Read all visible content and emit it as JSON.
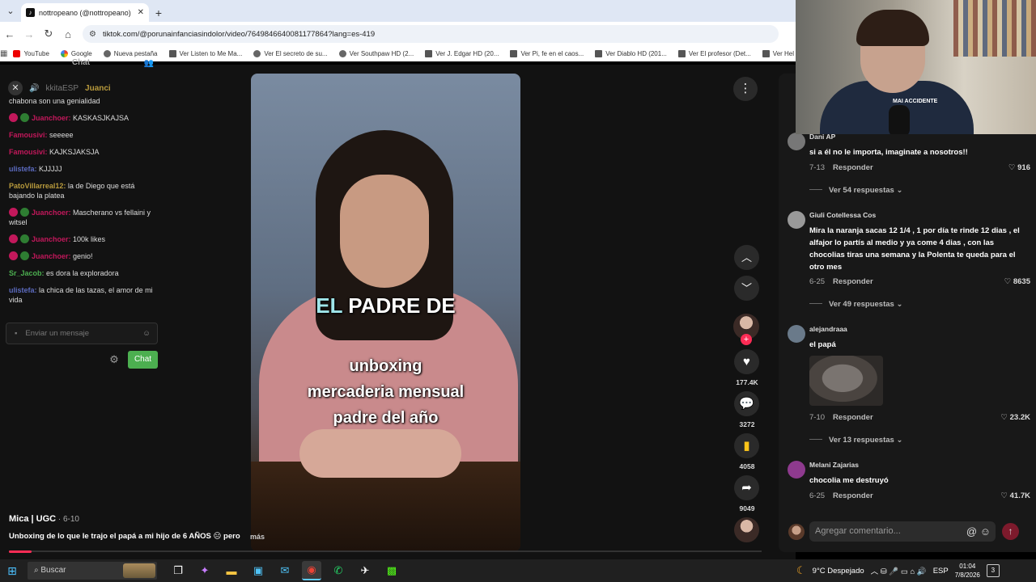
{
  "browser": {
    "tab_title": "nottropeano (@nottropeano) |",
    "url": "tiktok.com/@porunainfanciasindolor/video/7649846640081177864?lang=es-419",
    "bookmarks": [
      {
        "label": "YouTube",
        "icon": "youtube-icon"
      },
      {
        "label": "Google",
        "icon": "google-icon"
      },
      {
        "label": "Nueva pestaña",
        "icon": "globe-icon"
      },
      {
        "label": "Ver Listen to Me Ma...",
        "icon": "page-icon"
      },
      {
        "label": "Ver El secreto de su...",
        "icon": "globe-icon"
      },
      {
        "label": "Ver Southpaw HD (2...",
        "icon": "globe-icon"
      },
      {
        "label": "Ver J. Edgar HD (20...",
        "icon": "page-icon"
      },
      {
        "label": "Ver Pi, fe en el caos...",
        "icon": "page-icon"
      },
      {
        "label": "Ver Diablo HD (201...",
        "icon": "page-icon"
      },
      {
        "label": "Ver El profesor (Det...",
        "icon": "page-icon"
      },
      {
        "label": "Ver Hel",
        "icon": "page-icon"
      }
    ]
  },
  "chat": {
    "header": "Chat",
    "tabs": [
      "kkitaESP",
      "Juanci"
    ],
    "messages": [
      {
        "user": "",
        "text": "chabona son una genialidad",
        "color": "#dddddd",
        "badges": false
      },
      {
        "user": "Juanchoer:",
        "text": " KASKASJKAJSA",
        "color": "#c2185b",
        "badges": true
      },
      {
        "user": "Famousivi:",
        "text": " seeeee",
        "color": "#c2185b",
        "badges": false
      },
      {
        "user": "Famousivi:",
        "text": " KAJKSJAKSJA",
        "color": "#c2185b",
        "badges": false
      },
      {
        "user": "ulistefa:",
        "text": " KJJJJJ",
        "color": "#5c6bc0",
        "badges": false
      },
      {
        "user": "PatoVillarreal12:",
        "text": " la de Diego que está bajando la platea",
        "color": "#b89a3c",
        "badges": false
      },
      {
        "user": "Juanchoer:",
        "text": " Mascherano vs fellaini y witsel",
        "color": "#c2185b",
        "badges": true
      },
      {
        "user": "Juanchoer:",
        "text": " 100k likes",
        "color": "#c2185b",
        "badges": true
      },
      {
        "user": "Juanchoer:",
        "text": " genio!",
        "color": "#c2185b",
        "badges": true
      },
      {
        "user": "Sr_Jacob:",
        "text": " es dora la exploradora",
        "color": "#4caf50",
        "badges": false
      },
      {
        "user": "ulistefa:",
        "text": " la chica de las tazas, el amor de mi vida",
        "color": "#5c6bc0",
        "badges": false
      }
    ],
    "input_placeholder": "Enviar un mensaje",
    "send_label": "Chat"
  },
  "video": {
    "caption_hl": "EL",
    "caption_rest": " PADRE DE",
    "caption_lines": [
      "unboxing",
      "mercaderia mensual",
      "padre del año"
    ],
    "author": "Mica | UGC",
    "date": " · 6-10",
    "description": "Unboxing de lo que le trajo el papá a mi hijo de 6 AÑOS 😑 pero",
    "more": "más",
    "likes": "177.4K",
    "comments": "3272",
    "saves": "4058",
    "shares": "9049",
    "progress_pct": 3
  },
  "comments": [
    {
      "name": "Dani AP",
      "text": "si a él no le importa, imaginate a nosotros!!",
      "date": "7-13",
      "reply": "Responder",
      "likes": "916",
      "replies": "Ver 54 respuestas"
    },
    {
      "name": "Giuli Cotellessa Cos",
      "text": "Mira la naranja sacas 12 1/4 , 1 por día te rinde 12 dias , el alfajor lo partís al medio y ya come 4 dias , con las chocolias tiras una semana y la Polenta te queda para el otro mes",
      "date": "6-25",
      "reply": "Responder",
      "likes": "8635",
      "replies": "Ver 49 respuestas"
    },
    {
      "name": "alejandraaa",
      "text": "el papá",
      "date": "7-10",
      "reply": "Responder",
      "likes": "23.2K",
      "replies": "Ver 13 respuestas"
    },
    {
      "name": "Melani Zajarias",
      "text": "chocolia me destruyó",
      "date": "6-25",
      "reply": "Responder",
      "likes": "41.7K",
      "replies": ""
    }
  ],
  "comment_input_placeholder": "Agregar comentario...",
  "webcam": {
    "shirt_text": "MAI    ACCIDENTE"
  },
  "taskbar": {
    "search": "Buscar",
    "weather": "9°C  Despejado",
    "lang": "ESP",
    "time": "01:04",
    "date": "7/8/2026",
    "notifications": "3"
  }
}
